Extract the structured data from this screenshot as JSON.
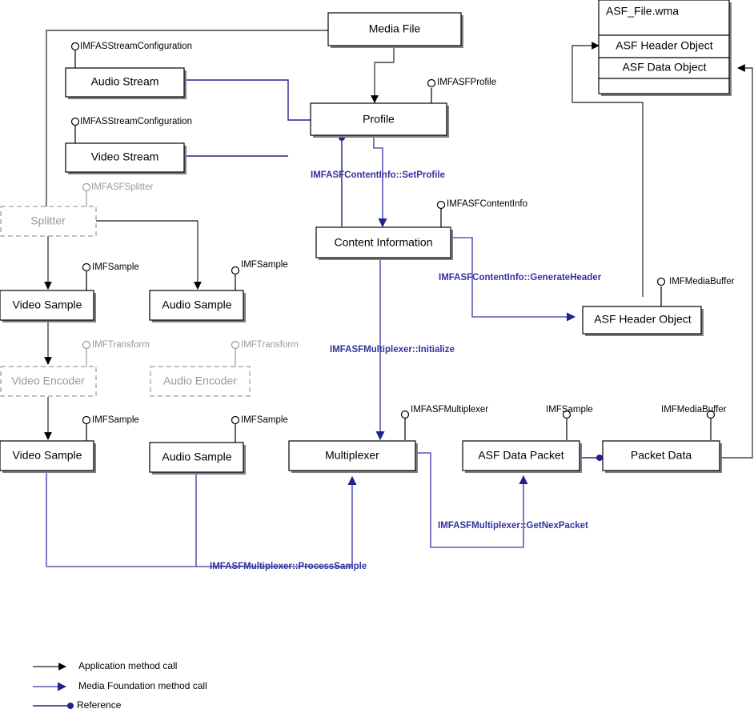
{
  "title": "ASF Media Foundation multiplexing architecture diagram",
  "colors": {
    "black_call": "#444444",
    "mf_call": "#5a5ab4",
    "reference": "#23238c",
    "mf_text": "#3333a0",
    "ghost": "#9a9a9a"
  },
  "boxes": {
    "media_file": "Media File",
    "audio_stream": "Audio Stream",
    "video_stream": "Video Stream",
    "splitter": "Splitter",
    "profile": "Profile",
    "content_information": "Content Information",
    "asf_header_object": "ASF Header Object",
    "video_sample_1": "Video Sample",
    "audio_sample_1": "Audio Sample",
    "video_encoder": "Video Encoder",
    "audio_encoder": "Audio Encoder",
    "video_sample_2": "Video Sample",
    "audio_sample_2": "Audio Sample",
    "multiplexer": "Multiplexer",
    "asf_data_packet": "ASF Data Packet",
    "packet_data": "Packet Data"
  },
  "asf_file": {
    "name": "ASF_File.wma",
    "rows": [
      "ASF Header Object",
      "ASF Data Object",
      ""
    ]
  },
  "interfaces": {
    "audio_stream_cfg": "IMFASStreamConfiguration",
    "video_stream_cfg": "IMFASStreamConfiguration",
    "splitter_iface": "IMFASFSplitter",
    "profile_iface": "IMFASFProfile",
    "content_info_iface": "IMFASFContentInfo",
    "video_sample_1_iface": "IMFSample",
    "audio_sample_1_iface": "IMFSample",
    "video_encoder_iface": "IMFTransform",
    "audio_encoder_iface": "IMFTransform",
    "video_sample_2_iface": "IMFSample",
    "audio_sample_2_iface": "IMFSample",
    "multiplexer_iface": "IMFASFMultiplexer",
    "asf_data_packet_iface": "IMFSample",
    "packet_data_iface": "IMFMediaBuffer",
    "asf_header_object_iface": "IMFMediaBuffer"
  },
  "method_calls": {
    "set_profile": "IMFASFContentInfo::SetProfile",
    "generate_header": "IMFASFContentInfo::GenerateHeader",
    "initialize": "IMFASFMultiplexer::Initialize",
    "process_sample": "IMFASFMultiplexer::ProcessSample",
    "get_next_packet": "IMFASFMultiplexer::GetNexPacket"
  },
  "legend": [
    {
      "key": "application-method-call",
      "label": "Application method call"
    },
    {
      "key": "media-foundation-method-call",
      "label": "Media Foundation method call"
    },
    {
      "key": "reference",
      "label": "Reference"
    }
  ]
}
